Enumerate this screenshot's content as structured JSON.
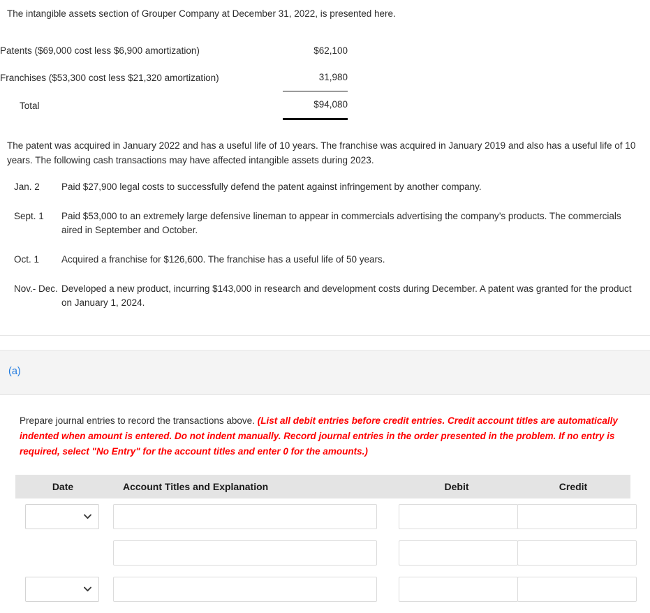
{
  "intro": {
    "text": "The intangible assets section of Grouper Company at December 31, 2022, is presented here."
  },
  "intangibles_table": {
    "rows": [
      {
        "label": "Patents ($69,000 cost less $6,900 amortization)",
        "amount": "$62,100",
        "rule": "none"
      },
      {
        "label": "Franchises ($53,300 cost less $21,320 amortization)",
        "amount": "31,980",
        "rule": "single"
      },
      {
        "label": "Total",
        "amount": "$94,080",
        "rule": "double"
      }
    ]
  },
  "body_paragraph": {
    "text": "The patent was acquired in January 2022 and has a useful life of 10 years. The franchise was acquired in January 2019 and also has a useful life of 10 years. The following cash transactions may have affected intangible assets during 2023."
  },
  "transactions": [
    {
      "date": "Jan. 2",
      "description": "Paid $27,900 legal costs to successfully defend the patent against infringement by another company."
    },
    {
      "date": "Sept. 1",
      "description": "Paid $53,000 to an extremely large defensive lineman to appear in commercials advertising the company’s products. The commercials aired in September and October."
    },
    {
      "date": "Oct. 1",
      "description": "Acquired a franchise for $126,600. The franchise has a useful life of 50 years."
    },
    {
      "date": "Nov.- Dec.",
      "description": "Developed a new product, incurring $143,000 in research and development costs during December. A patent was granted for the product on January 1, 2024."
    }
  ],
  "part": {
    "label": "(a)",
    "label_color": "#1f7ae0"
  },
  "requirement": {
    "black_text": "Prepare journal entries to record the transactions above. ",
    "red_text": "(List all debit entries before credit entries. Credit account titles are automatically indented when amount is entered. Do not indent manually. Record journal entries in the order presented in the problem. If no entry is required, select \"No Entry\" for the account titles and enter 0 for the amounts.)",
    "red_color": "#ff0000"
  },
  "journal": {
    "headers": {
      "date": "Date",
      "account": "Account Titles and Explanation",
      "debit": "Debit",
      "credit": "Credit"
    },
    "rows": [
      {
        "has_date_select": true,
        "date_value": "",
        "account_value": "",
        "debit_value": "",
        "credit_value": ""
      },
      {
        "has_date_select": false,
        "date_value": "",
        "account_value": "",
        "debit_value": "",
        "credit_value": ""
      },
      {
        "has_date_select": true,
        "date_value": "",
        "account_value": "",
        "debit_value": "",
        "credit_value": ""
      }
    ]
  }
}
